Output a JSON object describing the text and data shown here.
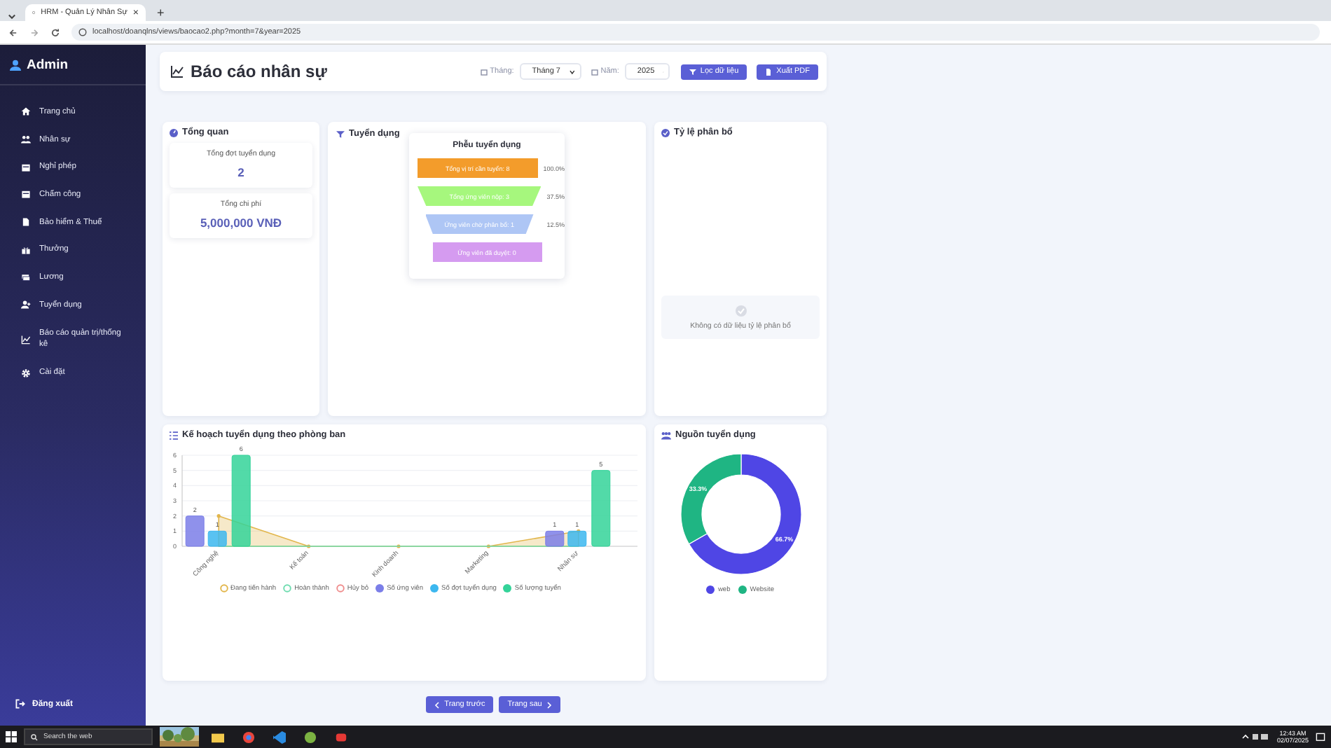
{
  "browser": {
    "tab_title": "HRM - Quản Lý Nhân Sự",
    "tab_close": "×",
    "new_tab": "+",
    "url": "localhost/doanqlns/views/baocao2.php?month=7&year=2025"
  },
  "sidebar": {
    "title": "Admin",
    "items": [
      {
        "label": "Trang chủ"
      },
      {
        "label": "Nhân sự"
      },
      {
        "label": "Nghỉ phép"
      },
      {
        "label": "Chấm công"
      },
      {
        "label": "Bảo hiểm & Thuế"
      },
      {
        "label": "Thưởng"
      },
      {
        "label": "Lương"
      },
      {
        "label": "Tuyển dụng"
      },
      {
        "label": "Báo cáo quản trị/thống kê"
      },
      {
        "label": "Cài đặt"
      }
    ],
    "logout": "Đăng xuất"
  },
  "header": {
    "title": "Báo cáo nhân sự",
    "month_label": "Tháng:",
    "month_value": "Tháng 7",
    "year_label": "Năm:",
    "year_value": "2025",
    "buttons": [
      "Lọc dữ liệu",
      "Xuất PDF"
    ]
  },
  "overview": {
    "title": "Tổng quan",
    "stats": [
      {
        "label": "Tổng đợt tuyển dụng",
        "value": "2"
      },
      {
        "label": "Tổng chi phí",
        "value": "5,000,000 VNĐ"
      }
    ]
  },
  "recruitment": {
    "title": "Tuyển dụng",
    "funnel": {
      "title": "Phễu tuyển dụng",
      "stages": [
        {
          "label": "Tổng vị trí cần tuyển: 8",
          "percent": "100.0%",
          "color": "#f39c2b",
          "kind": "bar"
        },
        {
          "label": "Tổng ứng viên nộp: 3",
          "percent": "37.5%",
          "color": "#a6f77d",
          "kind": "trapezoid"
        },
        {
          "label": "Ứng viên chờ phân bổ: 1",
          "percent": "12.5%",
          "color": "#aec6f5",
          "kind": "trapezoid"
        },
        {
          "label": "Ứng viên đã duyệt: 0",
          "color": "#d59bf0",
          "kind": "bar"
        }
      ]
    }
  },
  "allocation": {
    "title": "Tỷ lệ phân bổ",
    "empty_message": "Không có dữ liệu tỷ lệ phân bổ"
  },
  "plan": {
    "title": "Kế hoạch tuyển dụng theo phòng ban",
    "chart_data": {
      "type": "bar",
      "categories": [
        "Công nghệ",
        "Kế toán",
        "Kinh doanh",
        "Marketing",
        "Nhân sự"
      ],
      "ylim": [
        0,
        6
      ],
      "legend": true,
      "grid": true,
      "yticks": [
        0,
        1,
        2,
        3,
        4,
        5,
        6
      ],
      "value_labels": [
        [
          null,
          null,
          null,
          null,
          null
        ],
        [
          null,
          null,
          null,
          null,
          null
        ],
        [
          null,
          null,
          null,
          null,
          null
        ],
        [
          "2",
          null,
          null,
          null,
          "1"
        ],
        [
          "1",
          null,
          null,
          null,
          "1"
        ],
        [
          "6",
          null,
          null,
          null,
          "5"
        ]
      ],
      "series": [
        {
          "name": "Đang tiến hành",
          "type": "area",
          "color": "#e2b64c",
          "values": [
            2,
            0,
            0,
            0,
            1
          ]
        },
        {
          "name": "Hoàn thành",
          "type": "line",
          "color": "#6fdcb0",
          "values": [
            0,
            0,
            0,
            0,
            0
          ]
        },
        {
          "name": "Hủy bỏ",
          "type": "line",
          "color": "#ef8d8d",
          "values": [
            null,
            null,
            null,
            null,
            null
          ]
        },
        {
          "name": "Số ứng viên",
          "type": "bar",
          "color": "#7b7ee8",
          "values": [
            2,
            0,
            0,
            0,
            1
          ]
        },
        {
          "name": "Số đợt tuyển dụng",
          "type": "bar",
          "color": "#3cb7ef",
          "values": [
            1,
            0,
            0,
            0,
            1
          ]
        },
        {
          "name": "Số lượng tuyển",
          "type": "bar",
          "color": "#34d399",
          "values": [
            6,
            0,
            0,
            0,
            5
          ]
        }
      ]
    }
  },
  "sources": {
    "title": "Nguồn tuyển dụng",
    "chart_data": {
      "type": "donut",
      "categories": [
        "web",
        "Website"
      ],
      "values": [
        66.7,
        33.3
      ],
      "legend": true,
      "colors": [
        "#4f46e5",
        "#1fb583"
      ],
      "value_labels": [
        "66.7%",
        "33.3%"
      ]
    }
  },
  "pagination": [
    "Trang trước",
    "Trang sau"
  ],
  "taskbar": {
    "search_placeholder": "Search the web",
    "time": "12:43 AM",
    "date": "02/07/2025"
  }
}
